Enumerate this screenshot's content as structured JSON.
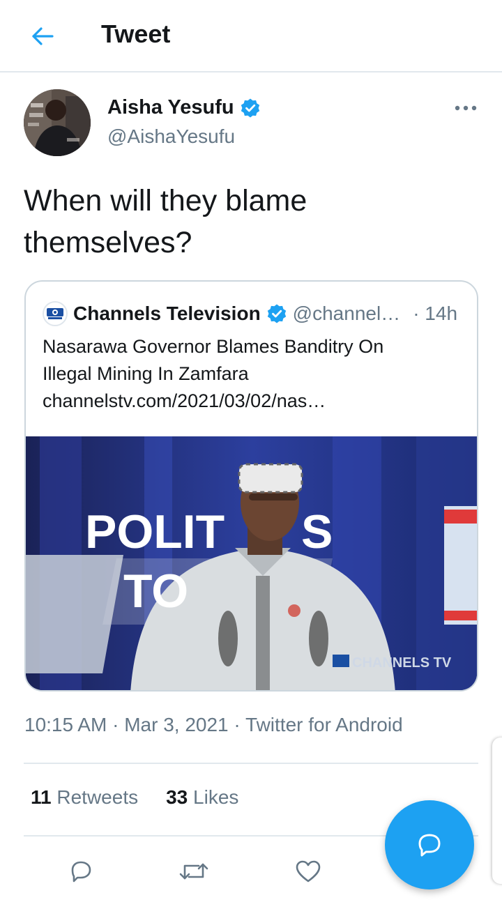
{
  "header": {
    "title": "Tweet",
    "back_icon": "arrow-left-icon"
  },
  "author": {
    "name": "Aisha Yesufu",
    "handle": "@AishaYesufu",
    "verified": true,
    "avatar_icon": "avatar-photo"
  },
  "tweet": {
    "text": "When will they blame themselves?"
  },
  "quoted": {
    "name": "Channels Television",
    "handle": "@channel…",
    "separator": "·",
    "time": "14h",
    "verified": true,
    "text_line1": "Nasarawa Governor Blames Banditry On",
    "text_line2": "Illegal Mining In Zamfara",
    "link": "channelstv.com/2021/03/02/nas…",
    "image": {
      "overlay_word1": "POLIT",
      "overlay_word2": "S",
      "overlay_word3": "TO",
      "watermark": "CHANNELS TV"
    }
  },
  "meta": {
    "time": "10:15 AM",
    "date": "Mar 3, 2021",
    "source": "Twitter for Android",
    "sep": "·"
  },
  "stats": {
    "retweets_count": "11",
    "retweets_label": "Retweets",
    "likes_count": "33",
    "likes_label": "Likes"
  },
  "colors": {
    "accent": "#1da1f2",
    "text": "#14171a",
    "secondary": "#657786",
    "border": "#e1e8ed"
  }
}
